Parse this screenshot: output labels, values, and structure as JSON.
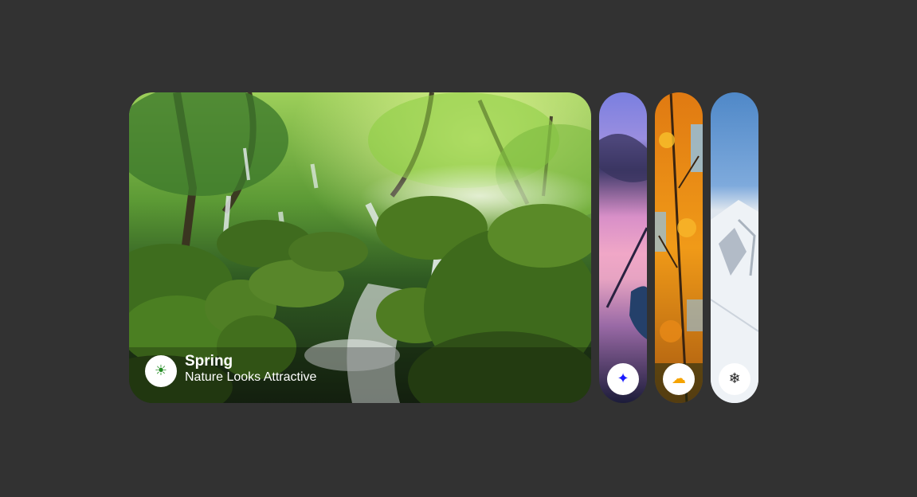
{
  "cards": [
    {
      "id": "spring",
      "title": "Spring",
      "subtitle": "Nature Looks Attractive",
      "icon": "sun-icon",
      "glyph": "☀",
      "icon_color": "#228b22",
      "active": true
    },
    {
      "id": "sunset",
      "icon": "sparkle-icon",
      "glyph": "✦",
      "icon_color": "#1a1aff",
      "active": false
    },
    {
      "id": "autumn",
      "icon": "cloud-rain-icon",
      "glyph": "☁",
      "icon_color": "#f5a300",
      "active": false
    },
    {
      "id": "winter",
      "icon": "snowflake-icon",
      "glyph": "❄",
      "icon_color": "#222222",
      "active": false
    }
  ]
}
